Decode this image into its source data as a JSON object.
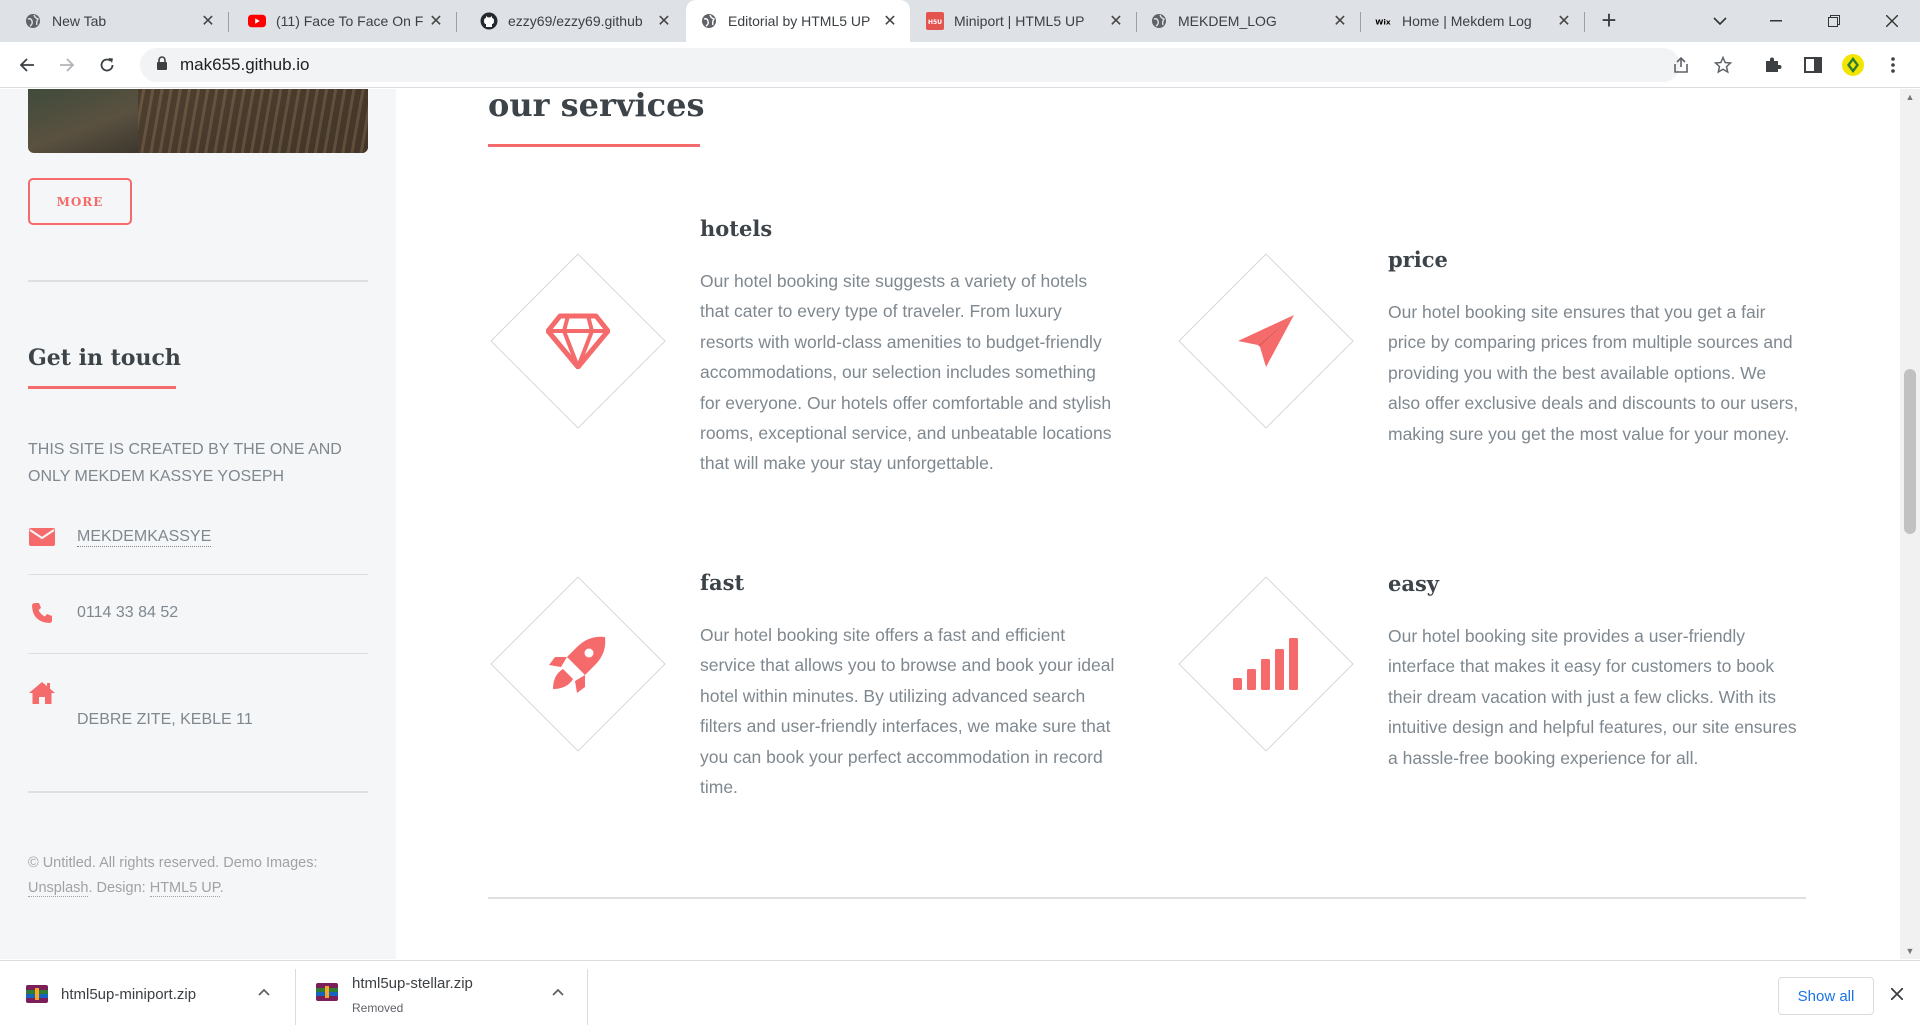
{
  "browser": {
    "tabs": [
      {
        "title": "New Tab",
        "icon": "globe-icon"
      },
      {
        "title": "(11) Face To Face On F",
        "icon": "youtube-icon"
      },
      {
        "title": "ezzy69/ezzy69.github",
        "icon": "github-icon"
      },
      {
        "title": "Editorial by HTML5 UP",
        "icon": "globe-icon",
        "active": true
      },
      {
        "title": "Miniport | HTML5 UP",
        "icon": "html5up-icon"
      },
      {
        "title": "MEKDEM_LOG",
        "icon": "globe-icon"
      },
      {
        "title": "Home | Mekdem Log",
        "icon": "wix-icon"
      }
    ],
    "url": "mak655.github.io",
    "accent": "#f56a6a"
  },
  "sidebar": {
    "more_label": "MORE",
    "contact_heading": "Get in touch",
    "contact_text": "THIS SITE IS CREATED BY THE ONE AND ONLY MEKDEM KASSYE YOSEPH",
    "contacts": [
      {
        "icon": "envelope-icon",
        "value": "MEKDEMKASSYE"
      },
      {
        "icon": "phone-icon",
        "value": "0114 33 84 52"
      },
      {
        "icon": "home-icon",
        "value": "DEBRE ZITE, KEBLE 11"
      }
    ],
    "copyright_prefix": "© Untitled. All rights reserved. Demo Images:",
    "copyright_link1": "Unsplash",
    "copyright_mid": ". Design:",
    "copyright_link2": "HTML5 UP",
    "copyright_end": "."
  },
  "main": {
    "section_title": "our services",
    "features": [
      {
        "icon": "diamond-gem-icon",
        "title": "hotels",
        "text": "Our hotel booking site suggests a variety of hotels that cater to every type of traveler. From luxury resorts with world-class amenities to budget-friendly accommodations, our selection includes something for everyone. Our hotels offer comfortable and stylish rooms, exceptional service, and unbeatable locations that will make your stay unforgettable."
      },
      {
        "icon": "paper-plane-icon",
        "title": "price",
        "text": "Our hotel booking site ensures that you get a fair price by comparing prices from multiple sources and providing you with the best available options. We also offer exclusive deals and discounts to our users, making sure you get the most value for your money."
      },
      {
        "icon": "rocket-icon",
        "title": "fast",
        "text": "Our hotel booking site offers a fast and efficient service that allows you to browse and book your ideal hotel within minutes. By utilizing advanced search filters and user-friendly interfaces, we make sure that you can book your perfect accommodation in record time."
      },
      {
        "icon": "signal-bars-icon",
        "title": "easy",
        "text": "Our hotel booking site provides a user-friendly interface that makes it easy for customers to book their dream vacation with just a few clicks. With its intuitive design and helpful features, our site ensures a hassle-free booking experience for all."
      }
    ]
  },
  "downloads": {
    "items": [
      {
        "name": "html5up-miniport.zip",
        "status": ""
      },
      {
        "name": "html5up-stellar.zip",
        "status": "Removed"
      }
    ],
    "show_all_label": "Show all"
  }
}
